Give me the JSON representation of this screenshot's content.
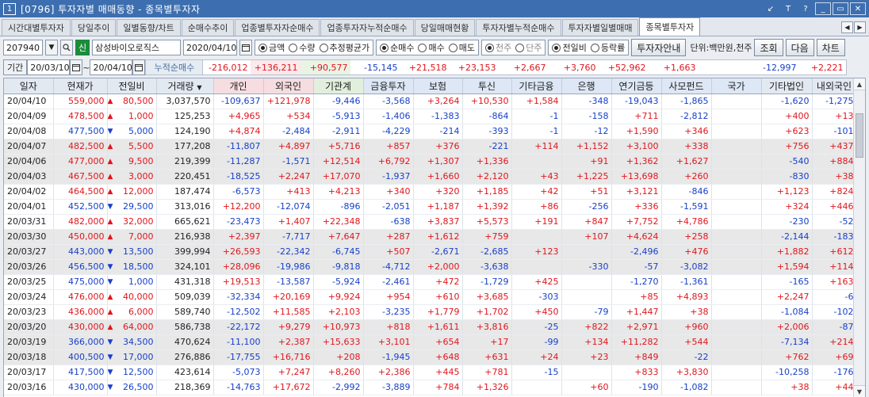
{
  "window": {
    "num": "1",
    "title": "[0796] 투자자별 매매동향 - 종목별투자자",
    "buttons": [
      "↙",
      "T",
      "?",
      "_",
      "▭",
      "✕"
    ]
  },
  "tabs": [
    "시간대별투자자",
    "당일추이",
    "일별동향/차트",
    "순매수추이",
    "업종별투자자순매수",
    "업종투자자누적순매수",
    "당일매매현황",
    "투자자별누적순매수",
    "투자자별일별매매",
    "종목별투자자"
  ],
  "active_tab_index": 9,
  "toolbar": {
    "code": "207940",
    "sin": "신",
    "stock_name": "삼성바이오로직스",
    "date": "2020/04/10",
    "radio_amount": [
      "금액",
      "수량",
      "추정평균가"
    ],
    "radio_type": [
      "순매수",
      "매수",
      "매도"
    ],
    "radio_unit": [
      "천주",
      "단주"
    ],
    "radio_view": [
      "전일비",
      "등락률"
    ],
    "investor_btn": "투자자안내",
    "unit_label": "단위:백만원,천주",
    "btn_query": "조회",
    "btn_next": "다음",
    "btn_chart": "차트"
  },
  "period": {
    "label": "기간",
    "from": "20/03/10",
    "tilde": "~",
    "to": "20/04/10",
    "cum_label": "누적순매수",
    "sums": [
      "-216,012",
      "+136,211",
      "+90,577",
      "-15,145",
      "+21,518",
      "+23,153",
      "+2,667",
      "+3,760",
      "+52,962",
      "+1,663",
      "",
      "-12,997",
      "+2,221"
    ]
  },
  "columns": [
    "일자",
    "현재가",
    "전일비",
    "거래량",
    "개인",
    "외국인",
    "기관계",
    "금융투자",
    "보험",
    "투신",
    "기타금융",
    "은행",
    "연기금등",
    "사모펀드",
    "국가",
    "기타법인",
    "내외국인"
  ],
  "rows": [
    [
      "20/04/10",
      "559,000",
      "▲",
      "80,500",
      "3,037,570",
      "-109,637",
      "+121,978",
      "-9,446",
      "-3,568",
      "+3,264",
      "+10,530",
      "+1,584",
      "-348",
      "-19,043",
      "-1,865",
      "",
      "-1,620",
      "-1,275"
    ],
    [
      "20/04/09",
      "478,500",
      "▲",
      "1,000",
      "125,253",
      "+4,965",
      "+534",
      "-5,913",
      "-1,406",
      "-1,383",
      "-864",
      "-1",
      "-158",
      "+711",
      "-2,812",
      "",
      "+400",
      "+13"
    ],
    [
      "20/04/08",
      "477,500",
      "▼",
      "5,000",
      "124,190",
      "+4,874",
      "-2,484",
      "-2,911",
      "-4,229",
      "-214",
      "-393",
      "-1",
      "-12",
      "+1,590",
      "+346",
      "",
      "+623",
      "-101"
    ],
    [
      "20/04/07",
      "482,500",
      "▲",
      "5,500",
      "177,208",
      "-11,807",
      "+4,897",
      "+5,716",
      "+857",
      "+376",
      "-221",
      "+114",
      "+1,152",
      "+3,100",
      "+338",
      "",
      "+756",
      "+437"
    ],
    [
      "20/04/06",
      "477,000",
      "▲",
      "9,500",
      "219,399",
      "-11,287",
      "-1,571",
      "+12,514",
      "+6,792",
      "+1,307",
      "+1,336",
      "",
      "+91",
      "+1,362",
      "+1,627",
      "",
      "-540",
      "+884"
    ],
    [
      "20/04/03",
      "467,500",
      "▲",
      "3,000",
      "220,451",
      "-18,525",
      "+2,247",
      "+17,070",
      "-1,937",
      "+1,660",
      "+2,120",
      "+43",
      "+1,225",
      "+13,698",
      "+260",
      "",
      "-830",
      "+38"
    ],
    [
      "20/04/02",
      "464,500",
      "▲",
      "12,000",
      "187,474",
      "-6,573",
      "+413",
      "+4,213",
      "+340",
      "+320",
      "+1,185",
      "+42",
      "+51",
      "+3,121",
      "-846",
      "",
      "+1,123",
      "+824"
    ],
    [
      "20/04/01",
      "452,500",
      "▼",
      "29,500",
      "313,016",
      "+12,200",
      "-12,074",
      "-896",
      "-2,051",
      "+1,187",
      "+1,392",
      "+86",
      "-256",
      "+336",
      "-1,591",
      "",
      "+324",
      "+446"
    ],
    [
      "20/03/31",
      "482,000",
      "▲",
      "32,000",
      "665,621",
      "-23,473",
      "+1,407",
      "+22,348",
      "-638",
      "+3,837",
      "+5,573",
      "+191",
      "+847",
      "+7,752",
      "+4,786",
      "",
      "-230",
      "-52"
    ],
    [
      "20/03/30",
      "450,000",
      "▲",
      "7,000",
      "216,938",
      "+2,397",
      "-7,717",
      "+7,647",
      "+287",
      "+1,612",
      "+759",
      "",
      "+107",
      "+4,624",
      "+258",
      "",
      "-2,144",
      "-183"
    ],
    [
      "20/03/27",
      "443,000",
      "▼",
      "13,500",
      "399,994",
      "+26,593",
      "-22,342",
      "-6,745",
      "+507",
      "-2,671",
      "-2,685",
      "+123",
      "",
      "-2,496",
      "+476",
      "",
      "+1,882",
      "+612"
    ],
    [
      "20/03/26",
      "456,500",
      "▼",
      "18,500",
      "324,101",
      "+28,096",
      "-19,986",
      "-9,818",
      "-4,712",
      "+2,000",
      "-3,638",
      "",
      "-330",
      "-57",
      "-3,082",
      "",
      "+1,594",
      "+114"
    ],
    [
      "20/03/25",
      "475,000",
      "▼",
      "1,000",
      "431,318",
      "+19,513",
      "-13,587",
      "-5,924",
      "-2,461",
      "+472",
      "-1,729",
      "+425",
      "",
      "-1,270",
      "-1,361",
      "",
      "-165",
      "+163"
    ],
    [
      "20/03/24",
      "476,000",
      "▲",
      "40,000",
      "509,039",
      "-32,334",
      "+20,169",
      "+9,924",
      "+954",
      "+610",
      "+3,685",
      "-303",
      "",
      "+85",
      "+4,893",
      "",
      "+2,247",
      "-6"
    ],
    [
      "20/03/23",
      "436,000",
      "▲",
      "6,000",
      "589,740",
      "-12,502",
      "+11,585",
      "+2,103",
      "-3,235",
      "+1,779",
      "+1,702",
      "+450",
      "-79",
      "+1,447",
      "+38",
      "",
      "-1,084",
      "-102"
    ],
    [
      "20/03/20",
      "430,000",
      "▲",
      "64,000",
      "586,738",
      "-22,172",
      "+9,279",
      "+10,973",
      "+818",
      "+1,611",
      "+3,816",
      "-25",
      "+822",
      "+2,971",
      "+960",
      "",
      "+2,006",
      "-87"
    ],
    [
      "20/03/19",
      "366,000",
      "▼",
      "34,500",
      "470,624",
      "-11,100",
      "+2,387",
      "+15,633",
      "+3,101",
      "+654",
      "+17",
      "-99",
      "+134",
      "+11,282",
      "+544",
      "",
      "-7,134",
      "+214"
    ],
    [
      "20/03/18",
      "400,500",
      "▼",
      "17,000",
      "276,886",
      "-17,755",
      "+16,716",
      "+208",
      "-1,945",
      "+648",
      "+631",
      "+24",
      "+23",
      "+849",
      "-22",
      "",
      "+762",
      "+69"
    ],
    [
      "20/03/17",
      "417,500",
      "▼",
      "12,500",
      "423,614",
      "-5,073",
      "+7,247",
      "+8,260",
      "+2,386",
      "+445",
      "+781",
      "-15",
      "",
      "+833",
      "+3,830",
      "",
      "-10,258",
      "-176"
    ],
    [
      "20/03/16",
      "430,000",
      "▼",
      "26,500",
      "218,369",
      "-14,763",
      "+17,672",
      "-2,992",
      "-3,889",
      "+784",
      "+1,326",
      "",
      "+60",
      "-190",
      "-1,082",
      "",
      "+38",
      "+44"
    ]
  ],
  "colors": {
    "up": "#e0161d",
    "down": "#1740c9",
    "title_bar": "#3d6fb0"
  }
}
